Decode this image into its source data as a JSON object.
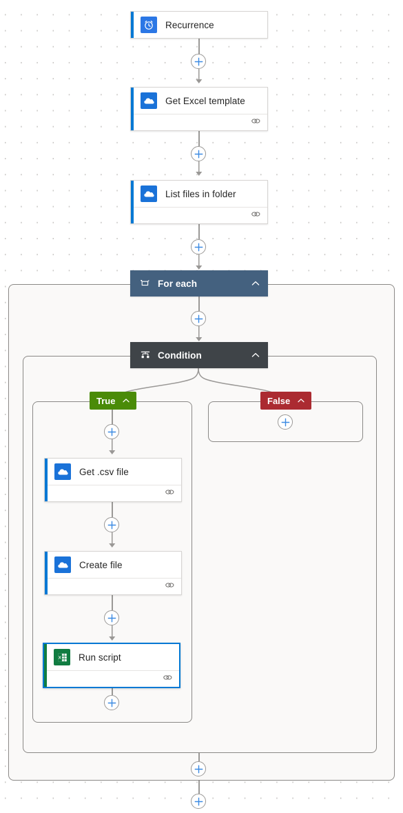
{
  "app": {
    "surface": "power-automate-flow-designer-canvas"
  },
  "nodes": {
    "trigger": {
      "label": "Recurrence",
      "icon": "clock-icon",
      "accent_color": "#0078d4",
      "icon_bg": "#2b77e5"
    },
    "get_excel_template": {
      "label": "Get Excel template",
      "icon": "onedrive-icon",
      "accent_color": "#0078d4",
      "icon_bg": "#1a72d8",
      "footer_icon": "link-icon"
    },
    "list_files": {
      "label": "List files in folder",
      "icon": "onedrive-icon",
      "accent_color": "#0078d4",
      "icon_bg": "#1a72d8",
      "footer_icon": "link-icon"
    },
    "for_each": {
      "label": "For each",
      "icon": "loop-icon",
      "collapse_icon": "chevron-up-icon",
      "header_color": "#44617f"
    },
    "condition": {
      "label": "Condition",
      "icon": "condition-icon",
      "collapse_icon": "chevron-up-icon",
      "header_color": "#3f4448"
    },
    "branch_true": {
      "label": "True",
      "collapse_icon": "chevron-up-icon",
      "color": "#4a8b08"
    },
    "branch_false": {
      "label": "False",
      "collapse_icon": "chevron-up-icon",
      "color": "#ab2b31"
    },
    "get_csv_file": {
      "label": "Get .csv file",
      "icon": "onedrive-icon",
      "accent_color": "#0078d4",
      "icon_bg": "#1a72d8",
      "footer_icon": "link-icon"
    },
    "create_file": {
      "label": "Create file",
      "icon": "onedrive-icon",
      "accent_color": "#0078d4",
      "icon_bg": "#1a72d8",
      "footer_icon": "link-icon"
    },
    "run_script": {
      "label": "Run script",
      "icon": "excel-icon",
      "accent_color": "#107c41",
      "icon_bg": "#107c41",
      "footer_icon": "link-icon",
      "selected": true,
      "selection_color": "#0078d4"
    }
  },
  "insert_buttons": {
    "icon": "plus-icon",
    "color": "#3b8ae2",
    "slots": [
      "after-recurrence",
      "after-get-excel-template",
      "after-list-files-in-folder",
      "after-for-each-header",
      "inside-false-branch",
      "top-of-true-branch",
      "between-get-csv-and-create-file",
      "between-create-file-and-run-script",
      "bottom-of-true-branch",
      "bottom-of-for-each",
      "end-of-flow"
    ]
  }
}
